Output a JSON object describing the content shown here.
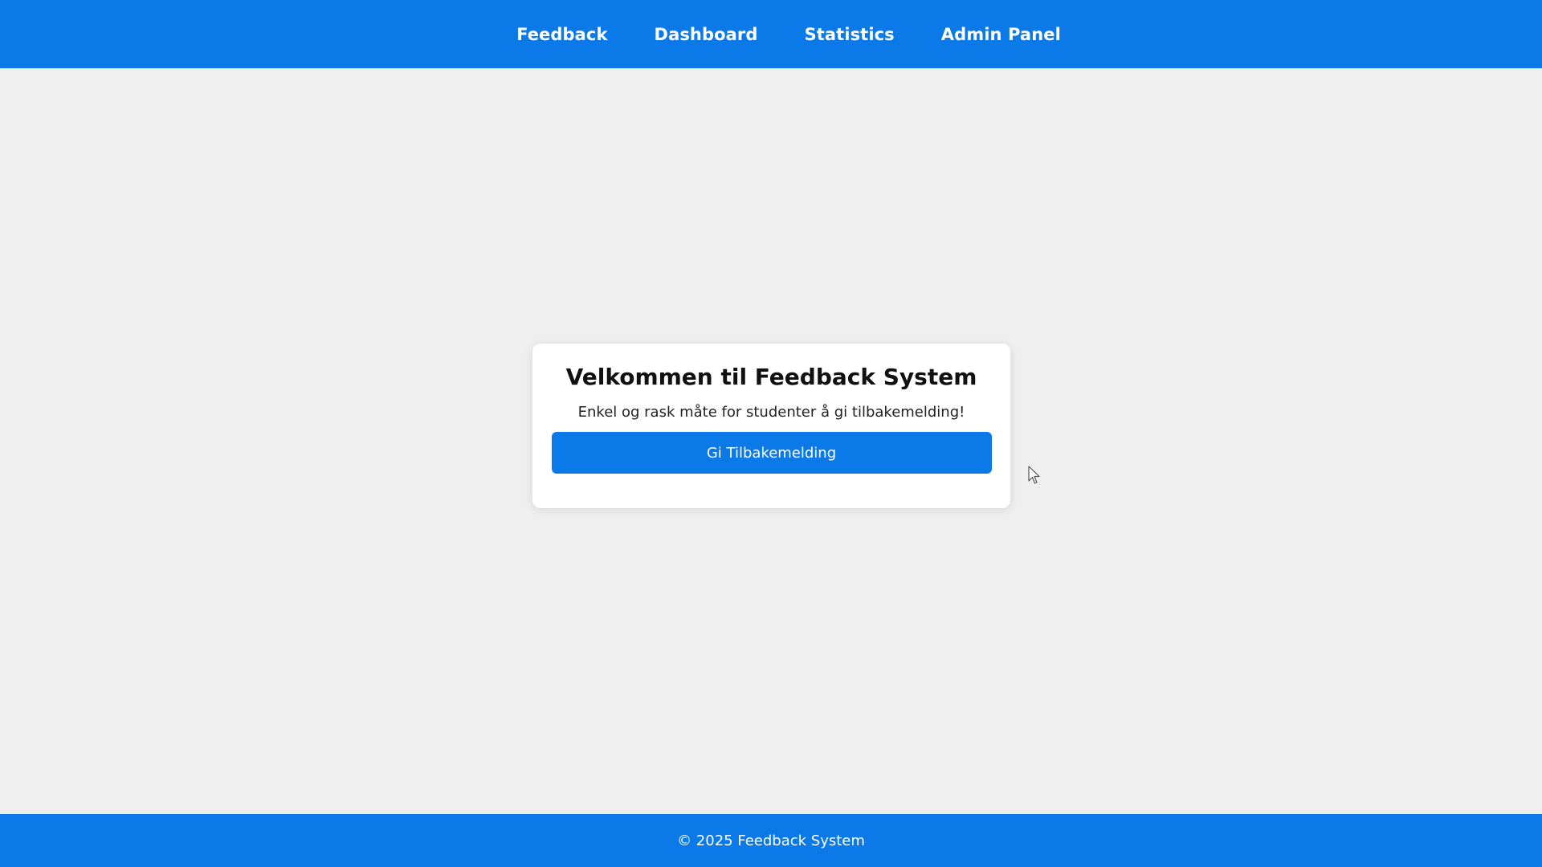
{
  "nav": {
    "items": [
      {
        "label": "Feedback"
      },
      {
        "label": "Dashboard"
      },
      {
        "label": "Statistics"
      },
      {
        "label": "Admin Panel"
      }
    ]
  },
  "card": {
    "title": "Velkommen til Feedback System",
    "subtitle": "Enkel og rask måte for studenter å gi tilbakemelding!",
    "button_label": "Gi Tilbakemelding"
  },
  "footer": {
    "text": "© 2025 Feedback System"
  },
  "cursor": {
    "icon": "mouse-pointer-icon"
  },
  "colors": {
    "brand": "#0b7ae8",
    "background": "#efefef",
    "card": "#ffffff"
  }
}
